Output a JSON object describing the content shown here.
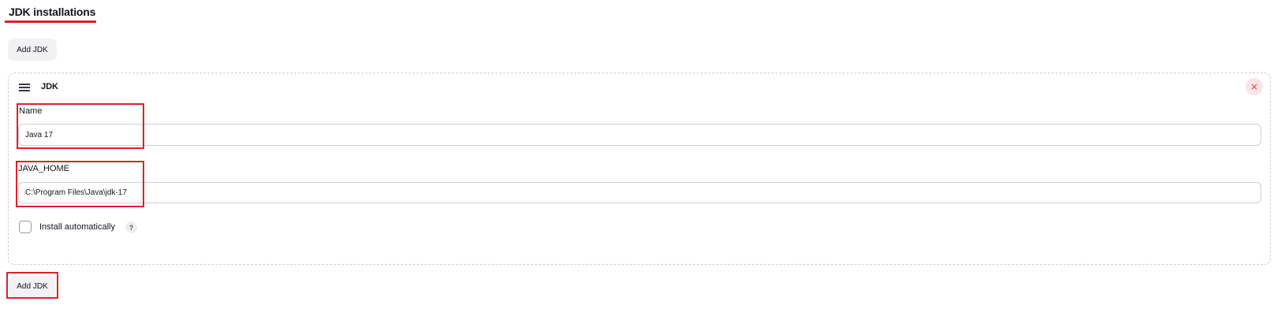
{
  "section": {
    "title": "JDK installations"
  },
  "buttons": {
    "add_top": "Add JDK",
    "add_bottom": "Add JDK"
  },
  "card": {
    "title": "JDK",
    "close_glyph": "×",
    "name_label": "Name",
    "name_value": "Java 17",
    "java_home_label": "JAVA_HOME",
    "java_home_value": "C:\\Program Files\\Java\\jdk-17",
    "install_label": "Install automatically",
    "install_checked": false,
    "help_glyph": "?"
  },
  "icons": {
    "drag": "drag-handle-icon",
    "close": "close-icon",
    "help": "help-icon"
  },
  "colors": {
    "highlight": "#e0202a",
    "close_bg": "#fde4e8",
    "close_fg": "#e0364f"
  }
}
